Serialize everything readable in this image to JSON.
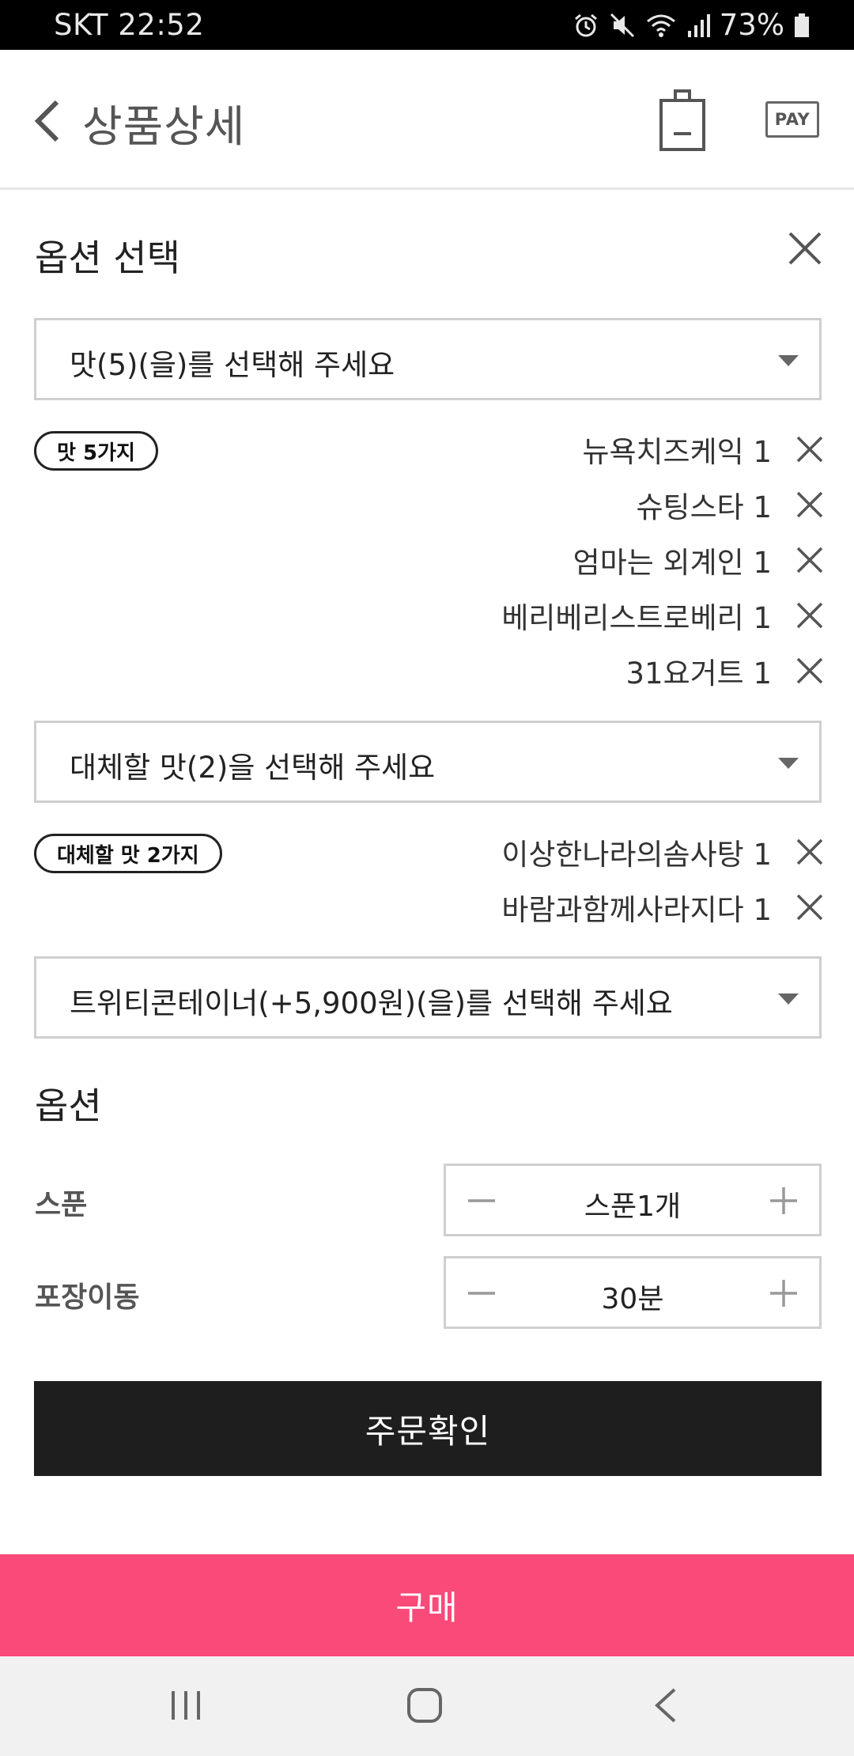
{
  "status_bar": {
    "carrier_time": "SKT 22:52",
    "battery": "73%",
    "icons": [
      "alarm-icon",
      "vibrate-mute-icon",
      "wifi-icon",
      "signal-icon",
      "battery-icon"
    ]
  },
  "header": {
    "title": "상품상세",
    "pay_label": "PAY"
  },
  "panel": {
    "title": "옵션 선택",
    "flavor_select_placeholder": "맛(5)(을)를 선택해 주세요",
    "flavor_pill": "맛 5가지",
    "flavors": [
      {
        "name": "뉴욕치즈케익",
        "qty": "1"
      },
      {
        "name": "슈팅스타",
        "qty": "1"
      },
      {
        "name": "엄마는 외계인",
        "qty": "1"
      },
      {
        "name": "베리베리스트로베리",
        "qty": "1"
      },
      {
        "name": "31요거트",
        "qty": "1"
      }
    ],
    "alt_select_placeholder": "대체할 맛(2)을 선택해 주세요",
    "alt_pill": "대체할 맛 2가지",
    "alternates": [
      {
        "name": "이상한나라의솜사탕",
        "qty": "1"
      },
      {
        "name": "바람과함께사라지다",
        "qty": "1"
      }
    ],
    "container_select_placeholder": "트위티콘테이너(+5,900원)(을)를 선택해 주세요"
  },
  "options": {
    "title": "옵션",
    "spoon": {
      "label": "스푼",
      "value": "스푼1개"
    },
    "packing": {
      "label": "포장이동",
      "value": "30분"
    }
  },
  "buttons": {
    "confirm": "주문확인",
    "buy": "구매"
  },
  "colors": {
    "buy_accent": "#fa4a79",
    "confirm_bg": "#1e1e1e"
  }
}
